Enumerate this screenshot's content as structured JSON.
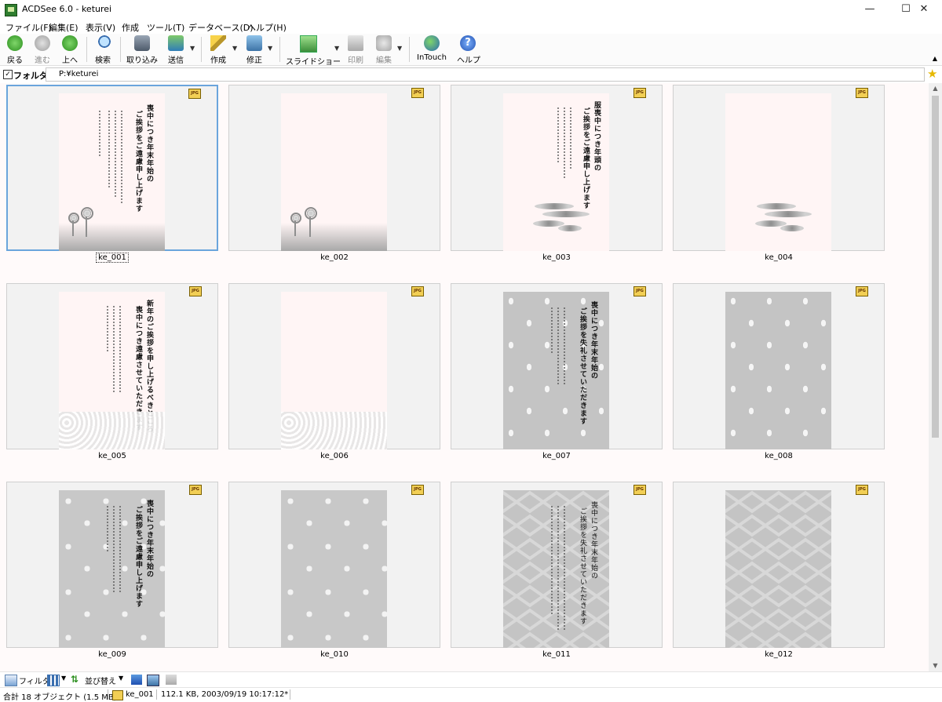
{
  "window": {
    "title": "ACDSee 6.0 - keturei"
  },
  "menu": [
    "ファイル(F)",
    "編集(E)",
    "表示(V)",
    "作成",
    "ツール(T)",
    "データベース(D)",
    "ヘルプ(H)"
  ],
  "toolbar": {
    "back": "戻る",
    "forward": "進む",
    "up": "上へ",
    "search": "検索",
    "import": "取り込み",
    "send": "送信",
    "create": "作成",
    "edit": "修正",
    "slideshow": "スライドショー",
    "print": "印刷",
    "editor": "編集",
    "intouch": "InTouch",
    "help": "ヘルプ"
  },
  "folder": {
    "label": "フォルダ:",
    "path": "P:¥keturei",
    "checked": true
  },
  "thumbnails": [
    {
      "name": "ke_001",
      "selected": true
    },
    {
      "name": "ke_002"
    },
    {
      "name": "ke_003"
    },
    {
      "name": "ke_004"
    },
    {
      "name": "ke_005"
    },
    {
      "name": "ke_006"
    },
    {
      "name": "ke_007"
    },
    {
      "name": "ke_008"
    },
    {
      "name": "ke_009"
    },
    {
      "name": "ke_010"
    },
    {
      "name": "ke_011"
    },
    {
      "name": "ke_012"
    }
  ],
  "card_text": {
    "t1_a": "喪中につき年末年始の",
    "t1_b": "ご挨拶をご遠慮申し上げます",
    "t3_a": "服喪中につき年頭の",
    "t3_b": "ご挨拶をご遠慮申し上げます",
    "t5_a": "新年のご挨拶を申し上げるべきところ",
    "t5_b": "喪中につき遠慮させていただきます",
    "t7_a": "喪中につき年末年始の",
    "t7_b": "ご挨拶を失礼させていただきます",
    "t9_a": "喪中につき年末年始の",
    "t9_b": "ご挨拶をご遠慮申し上げます",
    "t11_a": "喪中につき年末年始の",
    "t11_b": "ご挨拶を失礼させていただきます"
  },
  "bottombar": {
    "filter": "フィルタ",
    "sort": "並び替え"
  },
  "status": {
    "total": "合計 18 オブジェクト (1.5 MB)",
    "file": "ke_001",
    "info": "112.1 KB, 2003/09/19 10:17:12*"
  },
  "icons": {
    "jpg_badge": "JPG",
    "star": "star-icon",
    "back": "green-arrow-left-icon",
    "help": "blue-question-icon"
  }
}
